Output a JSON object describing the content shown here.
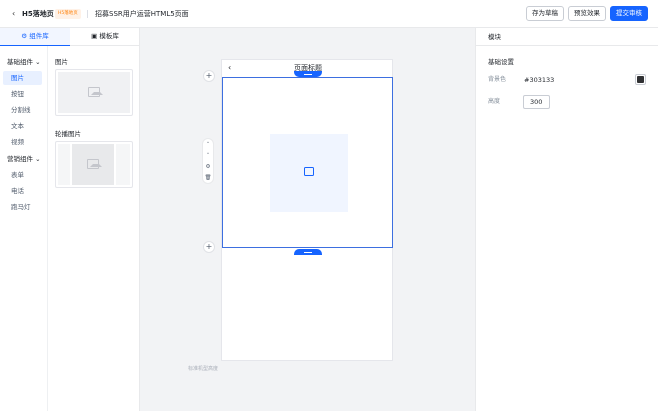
{
  "header": {
    "back_icon": "chevron-left-icon",
    "title": "H5落地页",
    "badge": "H5落地页",
    "page_name": "招募SSR用户运营HTML5页面",
    "buttons": {
      "save_draft": "存为草稿",
      "preview": "预览效果",
      "submit": "提交审核"
    }
  },
  "left_panel": {
    "tabs": [
      {
        "label": "组件库",
        "icon": "gear-icon",
        "active": true
      },
      {
        "label": "模板库",
        "icon": "template-icon",
        "active": false
      }
    ],
    "categories": [
      {
        "label": "基础组件",
        "items": [
          "图片",
          "按钮",
          "分割线",
          "文本",
          "视频"
        ]
      },
      {
        "label": "营销组件",
        "items": [
          "表单",
          "电话",
          "跑马灯"
        ]
      }
    ],
    "active_item": "图片",
    "components": [
      {
        "title": "图片"
      },
      {
        "title": "轮播图片"
      }
    ]
  },
  "canvas": {
    "page_title": "页面标题",
    "hint": "标准机型高度",
    "tools": [
      "chevron-up-icon",
      "chevron-down-icon",
      "settings-icon",
      "trash-icon"
    ]
  },
  "right_panel": {
    "title": "模块",
    "section": "基础设置",
    "bg_label": "背景色",
    "bg_value": "#303133",
    "height_label": "高度",
    "height_value": "300"
  },
  "colors": {
    "primary": "#1664ff",
    "swatch": "#303133",
    "badge_bg": "#fff1e6",
    "badge_text": "#ff7d00"
  }
}
